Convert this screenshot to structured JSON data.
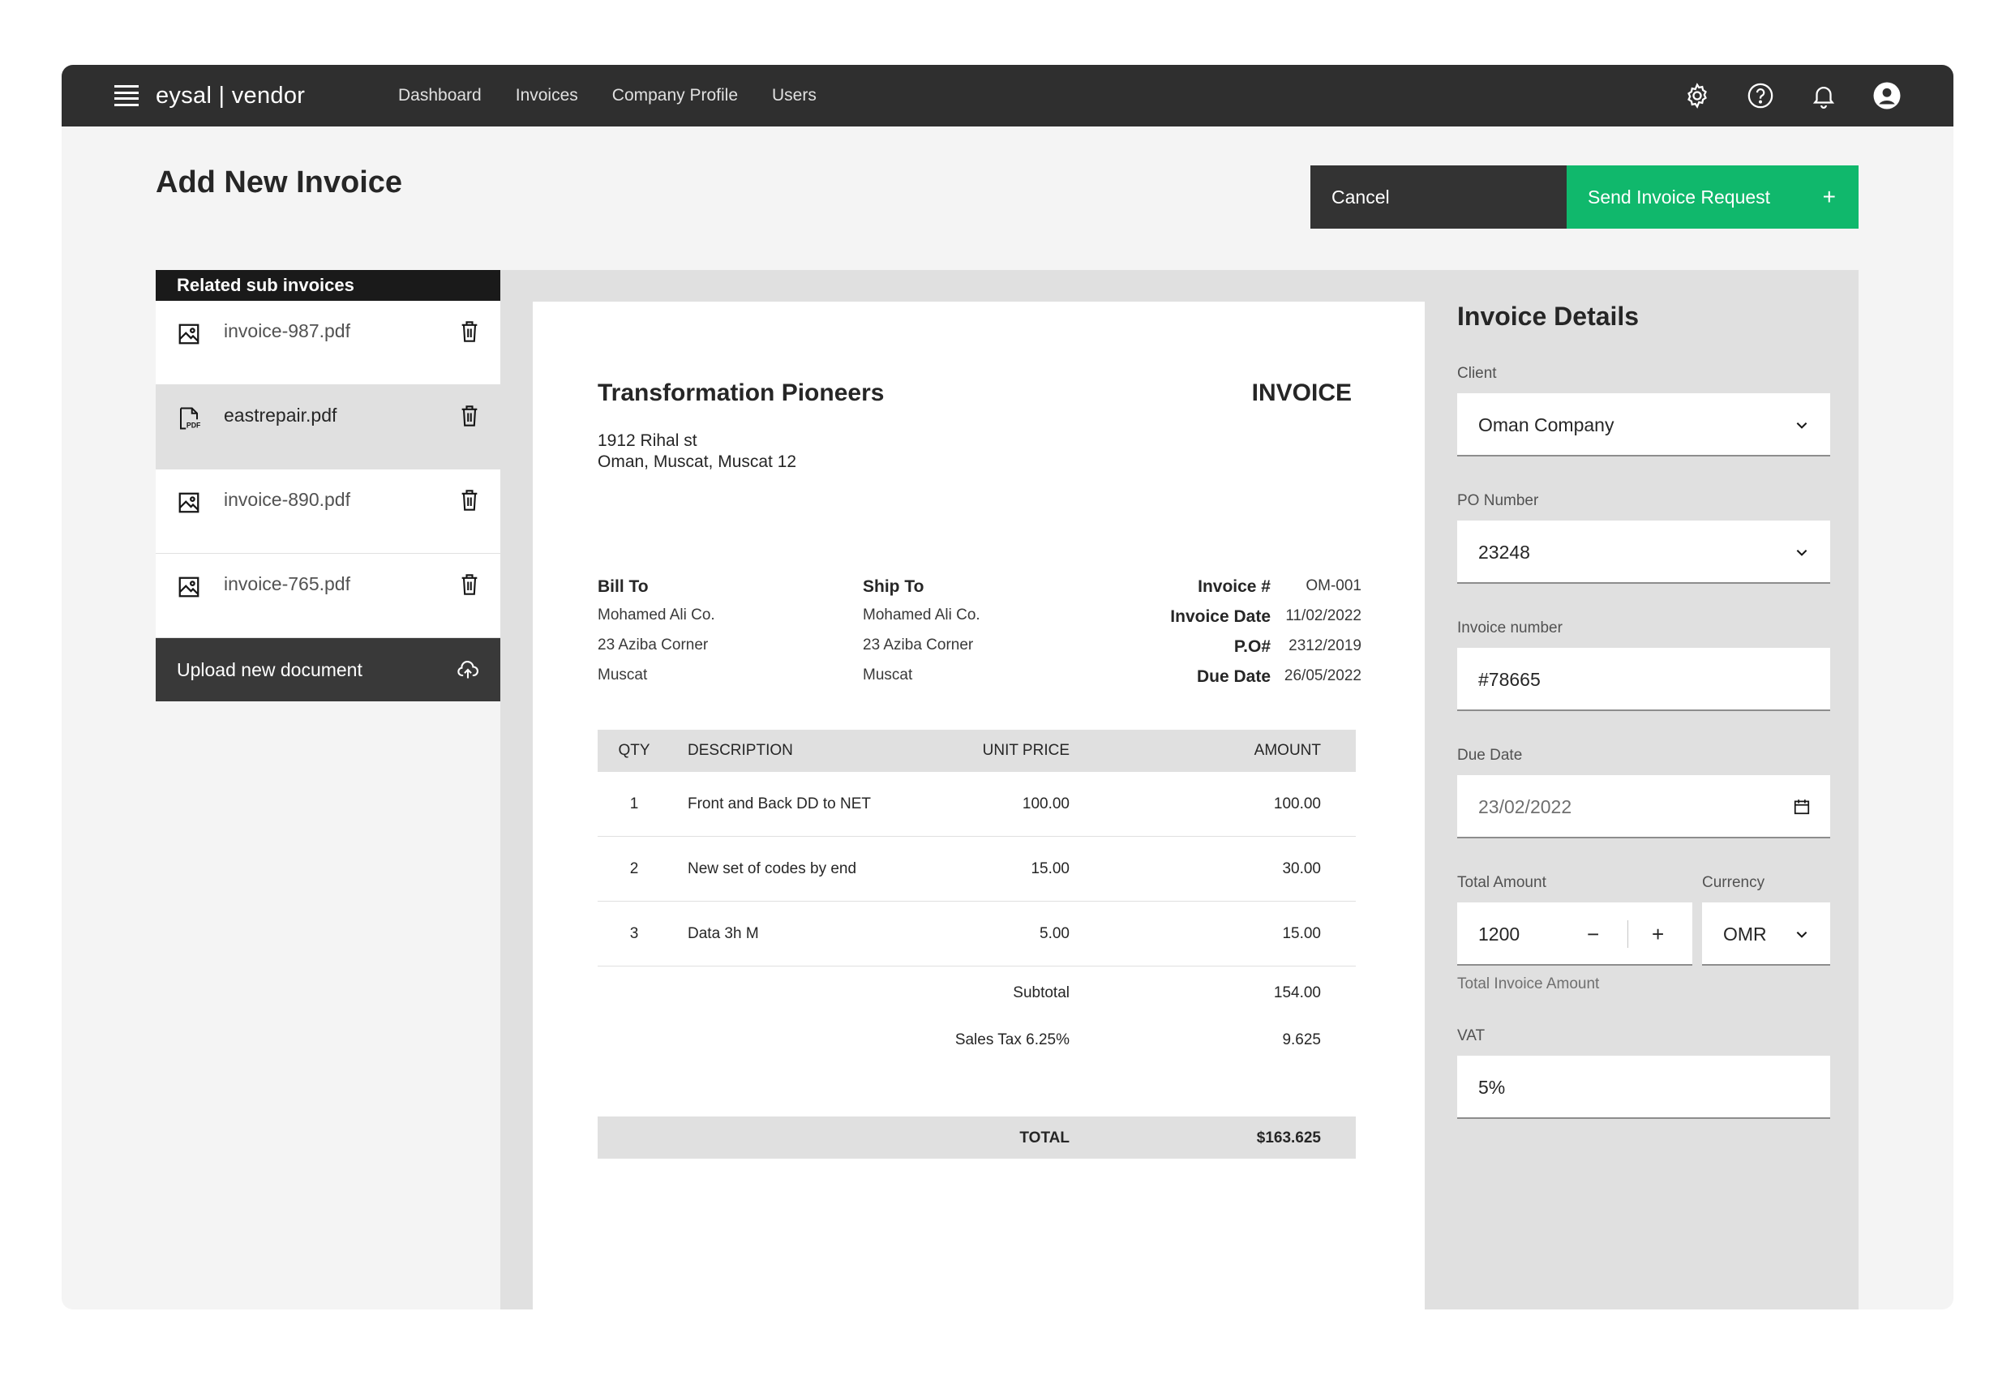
{
  "nav": {
    "brand": "eysal | vendor",
    "links": [
      "Dashboard",
      "Invoices",
      "Company Profile",
      "Users"
    ],
    "icons": [
      "settings-icon",
      "help-icon",
      "notification-icon",
      "user-icon"
    ]
  },
  "header": {
    "title": "Add New Invoice",
    "cancel_label": "Cancel",
    "send_label": "Send Invoice Request",
    "send_icon": "+"
  },
  "colors": {
    "accent": "#10b86c",
    "nav_bg": "#2f2f2f",
    "button_dark": "#333333"
  },
  "sub_invoices": {
    "header": "Related sub invoices",
    "files": [
      {
        "name": "invoice-987.pdf",
        "icon": "image-icon"
      },
      {
        "name": "eastrepair.pdf",
        "icon": "pdf-icon"
      },
      {
        "name": "invoice-890.pdf",
        "icon": "image-icon"
      },
      {
        "name": "invoice-765.pdf",
        "icon": "image-icon"
      }
    ],
    "upload_label": "Upload new document"
  },
  "invoice": {
    "company": "Transformation Pioneers",
    "doc_title": "INVOICE",
    "address_line1": "1912 Rihal st",
    "address_line2": "Oman, Muscat, Muscat 12",
    "bill_to": {
      "heading": "Bill To",
      "lines": [
        "Mohamed Ali Co.",
        "23 Aziba Corner",
        "Muscat"
      ]
    },
    "ship_to": {
      "heading": "Ship To",
      "lines": [
        "Mohamed Ali Co.",
        "23 Aziba Corner",
        "Muscat"
      ]
    },
    "meta": {
      "labels": [
        "Invoice #",
        "Invoice Date",
        "P.O#",
        "Due Date"
      ],
      "values": [
        "OM-001",
        "11/02/2022",
        "2312/2019",
        "26/05/2022"
      ]
    },
    "table": {
      "headers": [
        "QTY",
        "DESCRIPTION",
        "UNIT PRICE",
        "AMOUNT"
      ],
      "rows": [
        [
          "1",
          "Front and Back DD to NET",
          "100.00",
          "100.00"
        ],
        [
          "2",
          "New set of codes by end",
          "15.00",
          "30.00"
        ],
        [
          "3",
          "Data 3h M",
          "5.00",
          "15.00"
        ]
      ]
    },
    "subtotal_label": "Subtotal",
    "subtotal_value": "154.00",
    "tax_label": "Sales Tax 6.25%",
    "tax_value": "9.625",
    "total_label": "TOTAL",
    "total_value": "$163.625"
  },
  "details": {
    "title": "Invoice Details",
    "client_label": "Client",
    "client_value": "Oman Company",
    "po_label": "PO Number",
    "po_value": "23248",
    "invoice_number_label": "Invoice number",
    "invoice_number_value": "#78665",
    "due_date_label": "Due Date",
    "due_date_value": "23/02/2022",
    "total_amount_label": "Total Amount",
    "total_amount_value": "1200",
    "minus": "−",
    "plus": "+",
    "currency_label": "Currency",
    "currency_value": "OMR",
    "total_helper": "Total Invoice Amount",
    "vat_label": "VAT",
    "vat_value": "5%"
  }
}
